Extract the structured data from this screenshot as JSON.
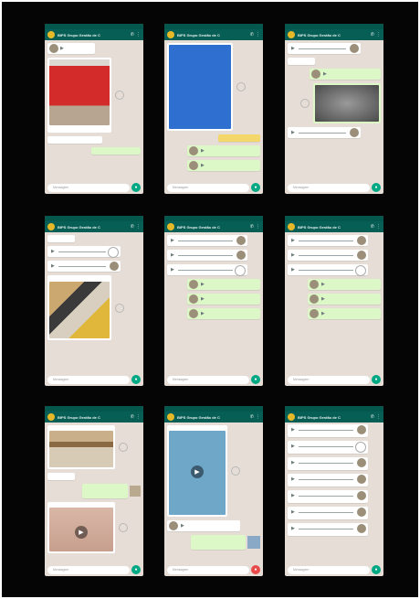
{
  "chat": {
    "title": "BIPS Grupo Gestão de C",
    "subtitle": "",
    "input_placeholder": "Mensagem",
    "colors": {
      "header": "#075e54",
      "statusbar": "#04574c",
      "background": "#e6ded6",
      "outgoing": "#dcf8c6",
      "incoming": "#ffffff",
      "accent": "#00a884",
      "avatar": "#e7b928"
    }
  },
  "icons": [
    "group-avatar",
    "video-call-icon",
    "call-icon",
    "more-icon",
    "play-icon",
    "forward-icon",
    "mic-icon",
    "emoji-icon",
    "attach-icon",
    "camera-icon"
  ]
}
